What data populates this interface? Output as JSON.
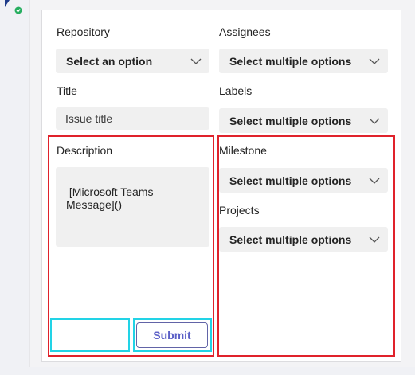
{
  "form": {
    "repository": {
      "label": "Repository",
      "value": "Select an option"
    },
    "assignees": {
      "label": "Assignees",
      "value": "Select multiple options"
    },
    "title": {
      "label": "Title",
      "placeholder": "Issue title"
    },
    "labels": {
      "label": "Labels",
      "value": "Select multiple options"
    },
    "description": {
      "label": "Description",
      "value": " [Microsoft Teams\nMessage]()"
    },
    "milestone": {
      "label": "Milestone",
      "value": "Select multiple options"
    },
    "projects": {
      "label": "Projects",
      "value": "Select multiple options"
    }
  },
  "buttons": {
    "submit_label": "Submit"
  },
  "icons": {
    "dropdown": "chevron-down-icon",
    "app": "app-logo-icon",
    "status": "check-badge-icon"
  },
  "colors": {
    "highlight_red": "#e0222b",
    "highlight_cyan": "#22d3e6",
    "accent": "#5b5fc7",
    "field_bg": "#f0f0f0",
    "status_green": "#27ae60"
  }
}
